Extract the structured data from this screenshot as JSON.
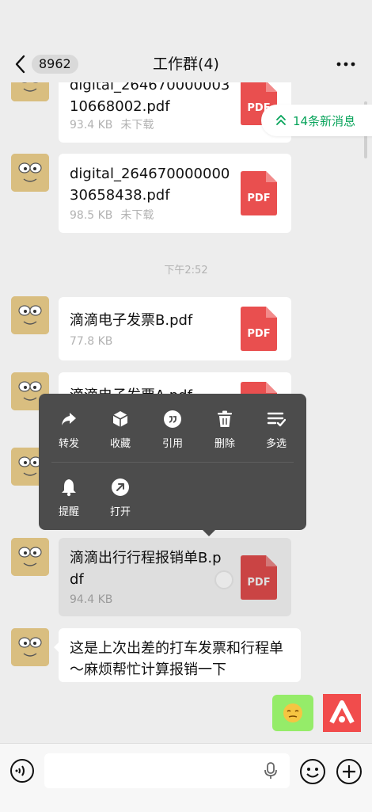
{
  "header": {
    "unread_count": "8962",
    "title": "工作群(4)"
  },
  "new_messages": {
    "label": "14条新消息"
  },
  "timestamp": "下午2:52",
  "messages": [
    {
      "file_name": "digital_26467000000310668002.pdf",
      "size": "93.4 KB",
      "status": "未下载"
    },
    {
      "file_name": "digital_26467000000030658438.pdf",
      "size": "98.5 KB",
      "status": "未下载"
    },
    {
      "file_name": "滴滴电子发票B.pdf",
      "size": "77.8 KB"
    },
    {
      "file_name": "滴滴电子发票A.pdf"
    },
    {
      "file_name": "滴滴出行行程报销单B.pdf",
      "size": "94.4 KB"
    }
  ],
  "text_message": "这是上次出差的打车发票和行程单～麻烦帮忙计算报销一下",
  "pdf_label": "PDF",
  "context_menu": {
    "items": [
      "转发",
      "收藏",
      "引用",
      "删除",
      "多选",
      "提醒",
      "打开"
    ]
  },
  "colors": {
    "background": "#ededed",
    "accent_green": "#07a35a",
    "pdf_red": "#e94f4f",
    "menu_bg": "#4c4c4c",
    "my_bubble": "#95ec69"
  },
  "icons": {
    "back": "chevron-left-icon",
    "more": "more-dots-icon",
    "forward": "forward-icon",
    "favorite": "cube-icon",
    "quote": "quote-icon",
    "delete": "trash-icon",
    "multi_select": "list-check-icon",
    "remind": "bell-icon",
    "open": "open-arrow-icon",
    "voice": "voice-icon",
    "mic": "mic-icon",
    "emoji": "emoji-icon",
    "plus": "plus-icon"
  }
}
